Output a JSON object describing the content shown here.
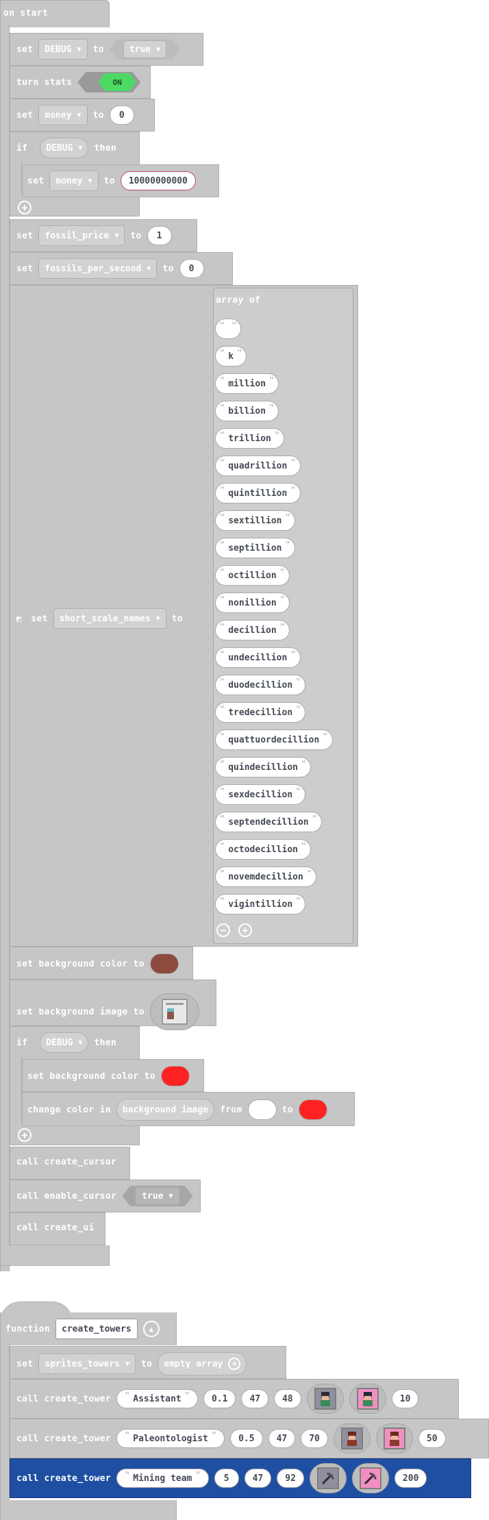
{
  "on_start": {
    "hat_label": "on start",
    "set_kw": "set",
    "to_kw": "to",
    "if_kw": "if",
    "then_kw": "then",
    "debug_var": "DEBUG",
    "true_value": "true",
    "turn_stats_label": "turn stats",
    "stats_toggle": "ON",
    "money_var": "money",
    "money_initial": "0",
    "money_debug": "10000000000",
    "fossil_price_var": "fossil_price",
    "fossil_price_value": "1",
    "fossils_per_second_var": "fossils_per_second",
    "fossils_per_second_value": "0",
    "short_scale_var": "short_scale_names",
    "array_of_label": "array of",
    "short_scale_names": [
      "",
      "k",
      "million",
      "billion",
      "trillion",
      "quadrillion",
      "quintillion",
      "sextillion",
      "septillion",
      "octillion",
      "nonillion",
      "decillion",
      "undecillion",
      "duodecillion",
      "tredecillion",
      "quattuordecillion",
      "quindecillion",
      "sexdecillion",
      "septendecillion",
      "octodecillion",
      "novemdecillion",
      "vigintillion"
    ],
    "set_bg_color_label": "set background color to",
    "bg_color": "#8d4a3f",
    "set_bg_image_label": "set background image to",
    "debug_bg_color": "#ff2222",
    "change_color_label": "change color in",
    "background_image_label": "background image",
    "from_kw": "from",
    "from_color": "#ffffff",
    "to_color": "#ff2222",
    "call_kw": "call",
    "create_cursor": "create_cursor",
    "enable_cursor": "enable_cursor",
    "enable_cursor_value": "true",
    "create_ui": "create_ui"
  },
  "create_towers": {
    "function_kw": "function",
    "name": "create_towers",
    "sprites_var": "sprites_towers",
    "empty_array_label": "empty array",
    "func_call": "create_tower",
    "towers": [
      {
        "name": "Assistant",
        "a": "0.1",
        "b": "47",
        "c": "48",
        "d": "10",
        "selected": false
      },
      {
        "name": "Paleontologist",
        "a": "0.5",
        "b": "47",
        "c": "70",
        "d": "50",
        "selected": false
      },
      {
        "name": "Mining team",
        "a": "5",
        "b": "47",
        "c": "92",
        "d": "200",
        "selected": true
      }
    ]
  },
  "colors": {
    "block_grey": "#c6c6c6",
    "selected_block": "#1f4fa3",
    "toggle_on": "#4cd964"
  },
  "icons": [
    "expand-triangle-icon",
    "add-circle-icon",
    "remove-circle-icon",
    "collapse-chevron-icon",
    "person-sprite-icon",
    "pickaxe-sprite-icon",
    "background-thumb-icon"
  ]
}
